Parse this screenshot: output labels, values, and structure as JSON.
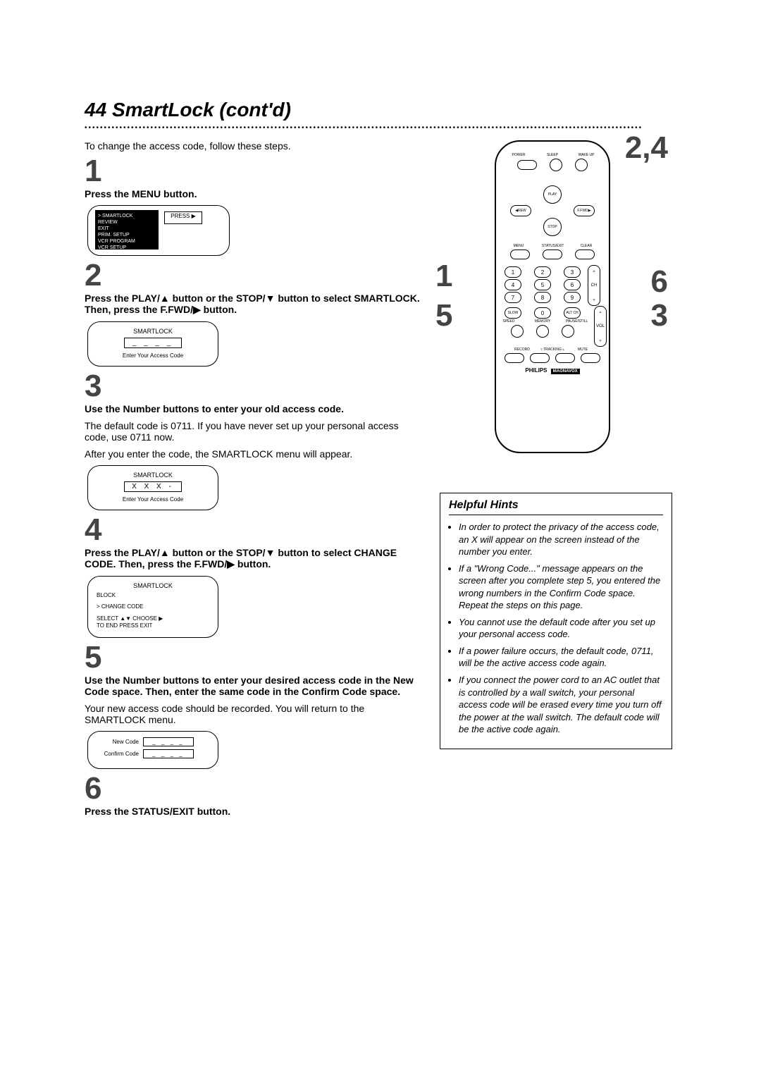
{
  "page": {
    "number": "44",
    "title": "SmartLock (cont'd)"
  },
  "intro": "To change the access code, follow these steps.",
  "steps": {
    "s1": {
      "num": "1",
      "head": "Press the MENU button.",
      "menu": {
        "l1": "> SMARTLOCK",
        "l2": "REVIEW",
        "l3": "EXIT",
        "l4": "PRIM. SETUP",
        "l5": "VCR PROGRAM",
        "l6": "VCR SETUP"
      },
      "press": "PRESS ▶"
    },
    "s2": {
      "num": "2",
      "head": "Press the PLAY/▲ button or the STOP/▼ button to select SMARTLOCK. Then, press the F.FWD/▶ button.",
      "tv_title": "SMARTLOCK",
      "code": "_ _ _ _",
      "caption": "Enter Your Access Code"
    },
    "s3": {
      "num": "3",
      "head": "Use the Number buttons to enter your old access code.",
      "body1": "The default code is 0711. If you have never set up your personal access code, use 0711 now.",
      "body2": "After you enter the code, the SMARTLOCK menu will appear.",
      "tv_title": "SMARTLOCK",
      "code": "X  X  X  -",
      "caption": "Enter Your Access Code"
    },
    "s4": {
      "num": "4",
      "head": "Press the PLAY/▲ button or the STOP/▼ button to select CHANGE CODE. Then, press the F.FWD/▶ button.",
      "tv_title": "SMARTLOCK",
      "l1": "BLOCK",
      "l2": "> CHANGE CODE",
      "l3": "SELECT ▲▼ CHOOSE ▶",
      "l4": "TO END PRESS EXIT"
    },
    "s5": {
      "num": "5",
      "head": "Use the Number buttons to enter your desired access code in the New Code space. Then, enter the same code in the Confirm Code space.",
      "body": "Your new access code should be recorded. You will return to the SMARTLOCK menu.",
      "label1": "New Code",
      "label2": "Confirm Code",
      "code": "_ _ _ _"
    },
    "s6": {
      "num": "6",
      "head": "Press the STATUS/EXIT button."
    }
  },
  "overlay": {
    "top_right": "2,4",
    "left_mid": "1",
    "left_low": "5",
    "right_mid": "6",
    "right_low": "3"
  },
  "remote": {
    "power": "POWER",
    "sleep": "SLEEP",
    "wake": "WAKE UP",
    "play": "PLAY",
    "rew": "REW",
    "ffwd": "F.FWD",
    "stop": "STOP",
    "menu": "MENU",
    "status": "STATUS/EXIT",
    "clear": "CLEAR",
    "ch": "CH",
    "vol": "VOL",
    "slow": "SLOW",
    "altch": "ALT CH",
    "speed": "SPEED",
    "memory": "MEMORY",
    "ps": "PAUSE/STILL",
    "record": "RECORD",
    "tracking": "TRACKING",
    "mute": "MUTE",
    "brand1": "PHILIPS",
    "brand2": "MAGNAVOX",
    "n1": "1",
    "n2": "2",
    "n3": "3",
    "n4": "4",
    "n5": "5",
    "n6": "6",
    "n7": "7",
    "n8": "8",
    "n9": "9",
    "n0": "0"
  },
  "hints": {
    "title": "Helpful Hints",
    "h1": "In order to protect the privacy of the access code, an X will appear on the screen instead of the number you enter.",
    "h2": "If a \"Wrong Code...\" message appears on the screen after you complete step 5, you entered the wrong numbers in the Confirm Code space. Repeat the steps on this page.",
    "h3": "You cannot use the default code after you set up your personal access code.",
    "h4": "If a power failure occurs, the default code, 0711, will be the active access code again.",
    "h5": "If you connect the power cord to an AC outlet that is controlled by a wall switch, your personal access code will be erased every time you turn off the power at the wall switch. The default code will be the active code again."
  }
}
